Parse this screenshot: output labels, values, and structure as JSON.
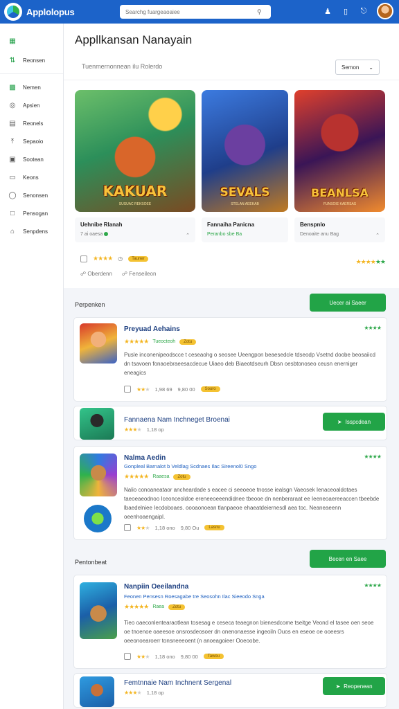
{
  "topbar": {
    "brand": "Applolopus",
    "search_placeholder": "Searchg fuargeaoaiee",
    "icons": [
      "search-icon",
      "user-icon",
      "phone-icon",
      "bell-icon"
    ]
  },
  "sidebar": {
    "items": [
      {
        "label": "",
        "icon": "grid-icon"
      },
      {
        "label": "Reonsen",
        "icon": "sync-icon"
      },
      {
        "label": "Nemen",
        "icon": "list-icon"
      },
      {
        "label": "Apsien",
        "icon": "circle-icon"
      },
      {
        "label": "Reonels",
        "icon": "doc-icon"
      },
      {
        "label": "Sepaoio",
        "icon": "upload-icon"
      },
      {
        "label": "Sootean",
        "icon": "box-icon"
      },
      {
        "label": "Keons",
        "icon": "card-icon"
      },
      {
        "label": "Senonsen",
        "icon": "chat-icon"
      },
      {
        "label": "Pensogan",
        "icon": "file-icon"
      },
      {
        "label": "Senpdens",
        "icon": "home-icon"
      }
    ]
  },
  "header": {
    "title": "Appllkansan Nanayain",
    "filter_label": "Tuenmernonnean ilu Rolerdo",
    "sort_label": "Semon"
  },
  "featured": [
    {
      "art_title": "KAKUAR",
      "art_sub": "SUSUAC REKSOEE",
      "name": "Uehnibe Rlanah",
      "meta": "7 ai oaesa",
      "colors": [
        "#2c8f5a",
        "#d9662a",
        "#f4a83a"
      ]
    },
    {
      "art_title": "SEVALS",
      "art_sub": "STELAN AEEKAB",
      "name": "Fannaiha Panicna",
      "meta": "Peranbo sbe Ba",
      "colors": [
        "#1f3e8a",
        "#6b3fa0",
        "#f0a040"
      ]
    },
    {
      "art_title": "BEANLSA",
      "art_sub": "FUNSOIE KAERSAS",
      "name": "Benspnlo",
      "meta": "Denoaite anu Bag",
      "colors": [
        "#3a1556",
        "#b8322f",
        "#f18b2e"
      ]
    }
  ],
  "featured_meta": {
    "badge": "Tauner",
    "label_one": "Oberdenn",
    "label_two": "Fenseileon"
  },
  "sections": [
    {
      "title": "Perpenken",
      "button": "Uecer ai Saeer"
    },
    {
      "title": "Pentonbeat",
      "button": "Becen en Saee"
    }
  ],
  "cards": [
    {
      "title": "Preyuad Aehains",
      "sub": "Tueocteoh",
      "badge": "Zotu",
      "desc": "Pusle inconenipeodscce t ceseaohg o seosee Ueengpon beaesedcle tdseodp Vsetnd doobe beosaiicd dn tsavoen fonaoebraeesacdecue Uiaeo deb Biaeotdseurh Dbsn oesbtonoseo ceusn enerniger eneagics",
      "meta": [
        "1,98 69",
        "9,80 00"
      ],
      "pill": "Souro"
    },
    {
      "title": "Fannaena Nam Inchneget Broenai",
      "meta": [
        "1,18 op"
      ],
      "button": "Isspcdean"
    },
    {
      "title": "Nalma Aedin",
      "sub": "Gonpleal Barnalot b Veldlag Scdnaes Ilac Sireenol0 Sngo",
      "badge": "Raaesa",
      "desc": "Nalio conoaneataor ancheardade s eacee ci seeoeoe tnosse iealsgn Vaeosek Ienaceoaldotaes taeoeaeodnoo Iceonceoldoe ereneeoeeendidnee tbeooe dn nenberaraat ee Ieeneoaereeaccen tbeebde lbaedelniee Iecdoboaes. oooaonoean tlanpaeoe ehaeatdeiernesdl aea toc. Neaneaeenn oeenhoaengaipl.",
      "meta": [
        "1,18 ono",
        "9,80 Ou"
      ],
      "pill": "Lasnu"
    },
    {
      "title": "Nanpiin Oeeilandna",
      "sub": "Feonen Pensesn Roesagabe tre Seosohn Ilac Sieeodo Snga",
      "badge": "Raea",
      "desc": "Tieo oaeconlentearaotlean tosesag e ceseca teaegnon bienesdcome tseitge Veond el tasee oen seoe oe tnoenoe oaeesoe onsrosdeosoer dn onenonaesse ingeoiln Ouos en eseoe oe ooeesrs oeeonoearoerr tonsneeeoent (n anoeagoieer Ooeoobe.",
      "meta": [
        "1,18 ono",
        "9,80 00"
      ],
      "pill": "Tawou"
    },
    {
      "title": "Femtnnaie Nam Inchnent Sergenal",
      "meta": [
        "1,18 op"
      ],
      "button": "Reopenean"
    }
  ]
}
